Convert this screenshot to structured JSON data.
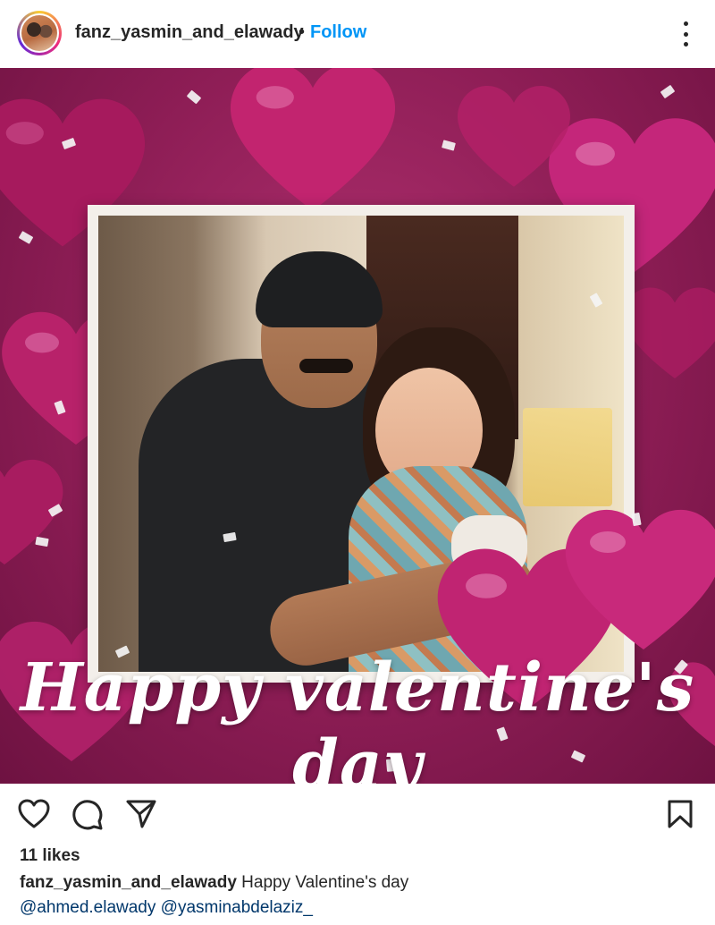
{
  "header": {
    "username": "fanz_yasmin_and_elawady",
    "separator": "•",
    "follow_label": "Follow"
  },
  "post": {
    "overlay_text": "Happy valentine's day"
  },
  "actions": {
    "icons": [
      "heart-icon",
      "comment-icon",
      "share-icon",
      "bookmark-icon"
    ]
  },
  "likes": "11 likes",
  "caption": {
    "username": "fanz_yasmin_and_elawady",
    "text": "Happy Valentine's day",
    "mentions": [
      "@ahmed.elawady",
      "@yasminabdelaziz_"
    ]
  },
  "colors": {
    "follow": "#0095f6",
    "mention": "#00376b",
    "background": "#8d1d55"
  }
}
